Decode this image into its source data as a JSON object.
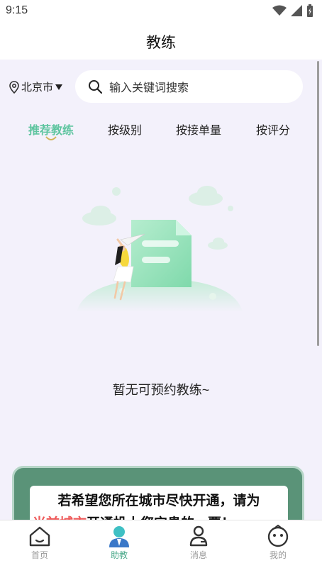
{
  "status_bar": {
    "time": "9:15"
  },
  "header": {
    "title": "教练"
  },
  "location": {
    "city": "北京市"
  },
  "search": {
    "placeholder": "输入关键词搜索"
  },
  "tabs": [
    {
      "label": "推荐教练",
      "active": true
    },
    {
      "label": "按级别",
      "active": false
    },
    {
      "label": "按接单量",
      "active": false
    },
    {
      "label": "按评分",
      "active": false
    }
  ],
  "empty_state": {
    "message": "暂无可预约教练~"
  },
  "banner": {
    "line1": "若希望您所在城市尽快开通，请为",
    "line2_highlight": "当前城市",
    "line2_rest": "开通投上您宝贵的一票！"
  },
  "bottom_nav": [
    {
      "label": "首页",
      "icon": "home-icon",
      "active": false
    },
    {
      "label": "助教",
      "icon": "coach-icon",
      "active": true
    },
    {
      "label": "消息",
      "icon": "message-icon",
      "active": false
    },
    {
      "label": "我的",
      "icon": "profile-icon",
      "active": false
    }
  ],
  "colors": {
    "accent": "#5fc5a0",
    "highlight": "#ef5a5a",
    "background": "#f3f1fb"
  }
}
